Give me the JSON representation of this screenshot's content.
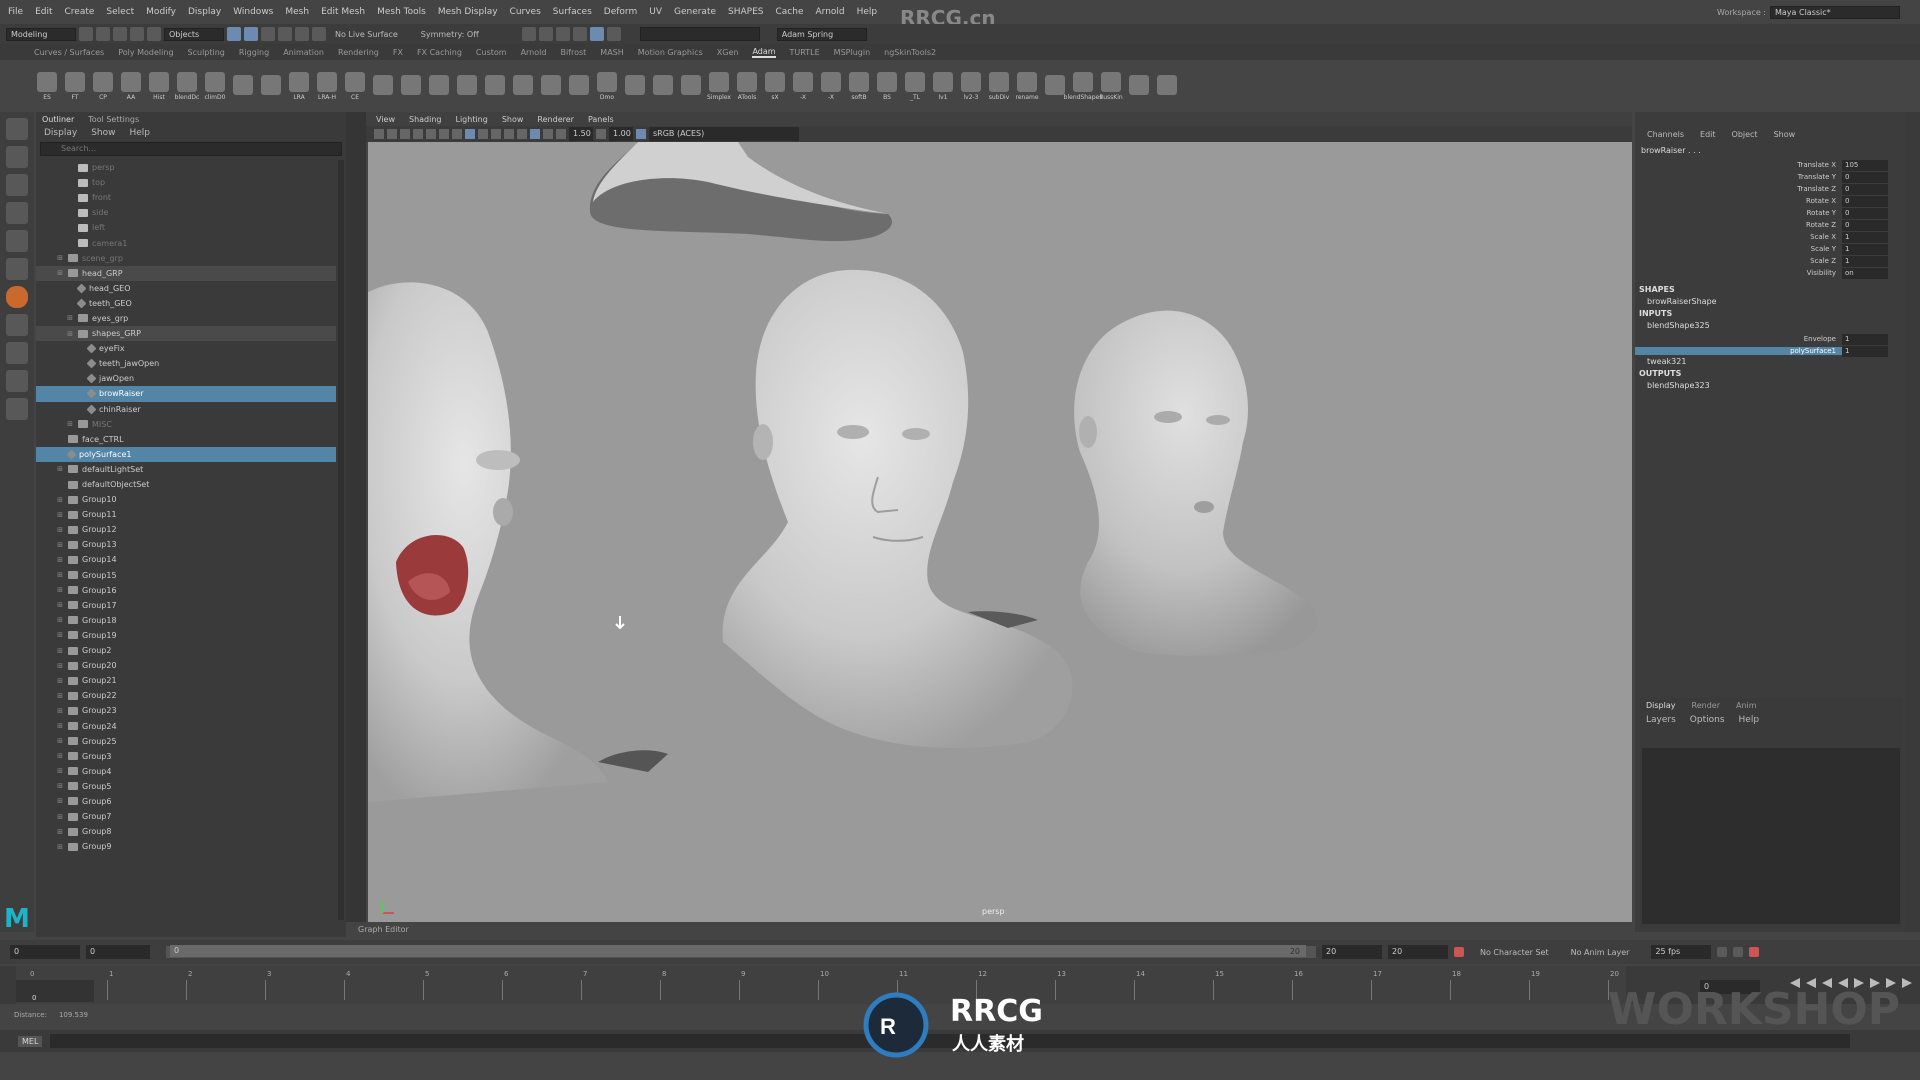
{
  "watermark": "RRCG.cn",
  "menubar": [
    "File",
    "Edit",
    "Create",
    "Select",
    "Modify",
    "Display",
    "Windows",
    "Mesh",
    "Edit Mesh",
    "Mesh Tools",
    "Mesh Display",
    "Curves",
    "Surfaces",
    "Deform",
    "UV",
    "Generate",
    "SHAPES",
    "Cache",
    "Arnold",
    "Help"
  ],
  "workspace": {
    "label": "Workspace :",
    "value": "Maya Classic*"
  },
  "statusline": {
    "mode": "Modeling",
    "objects": "Objects",
    "live": "No Live Surface",
    "symmetry": "Symmetry: Off",
    "user": "Adam Spring"
  },
  "shelf_tabs": [
    "Curves / Surfaces",
    "Poly Modeling",
    "Sculpting",
    "Rigging",
    "Animation",
    "Rendering",
    "FX",
    "FX Caching",
    "Custom",
    "Arnold",
    "Bifrost",
    "MASH",
    "Motion Graphics",
    "XGen",
    "Adam",
    "TURTLE",
    "MSPlugin",
    "ngSkinTools2"
  ],
  "shelf_active": "Adam",
  "shelf_icons": [
    "ES",
    "FT",
    "CP",
    "AA",
    "Hist",
    "blendDc",
    "climD0",
    "",
    "",
    "LRA",
    "LRA-H",
    "CE",
    "",
    "",
    "",
    "",
    "",
    "",
    "",
    "",
    "Dmo",
    "",
    "",
    "",
    "Simplex",
    "ATools",
    "sX",
    "-X",
    "-X",
    "softB",
    "BS",
    "_TL",
    "lv1",
    "lv2-3",
    "subDiv",
    "rename",
    "",
    "blendShapes",
    "RussKin",
    "",
    ""
  ],
  "outliner": {
    "tabs": [
      "Outliner",
      "Tool Settings"
    ],
    "menu": [
      "Display",
      "Show",
      "Help"
    ],
    "search": "Search..."
  },
  "tree": [
    {
      "label": "persp",
      "indent": 2,
      "icon": "cam",
      "dim": true
    },
    {
      "label": "top",
      "indent": 2,
      "icon": "cam",
      "dim": true
    },
    {
      "label": "front",
      "indent": 2,
      "icon": "cam",
      "dim": true
    },
    {
      "label": "side",
      "indent": 2,
      "icon": "cam",
      "dim": true
    },
    {
      "label": "left",
      "indent": 2,
      "icon": "cam",
      "dim": true
    },
    {
      "label": "camera1",
      "indent": 2,
      "icon": "cam",
      "dim": true
    },
    {
      "label": "scene_grp",
      "indent": 1,
      "icon": "grp",
      "exp": "+",
      "dim": true
    },
    {
      "label": "head_GRP",
      "indent": 1,
      "icon": "grp",
      "exp": "-",
      "grp": true
    },
    {
      "label": "head_GEO",
      "indent": 2,
      "icon": "geo"
    },
    {
      "label": "teeth_GEO",
      "indent": 2,
      "icon": "geo"
    },
    {
      "label": "eyes_grp",
      "indent": 2,
      "icon": "grp",
      "exp": "+"
    },
    {
      "label": "shapes_GRP",
      "indent": 2,
      "icon": "grp",
      "exp": "-",
      "grp": true
    },
    {
      "label": "eyeFix",
      "indent": 3,
      "icon": "geo"
    },
    {
      "label": "teeth_jawOpen",
      "indent": 3,
      "icon": "geo"
    },
    {
      "label": "jawOpen",
      "indent": 3,
      "icon": "geo"
    },
    {
      "label": "browRaiser",
      "indent": 3,
      "icon": "geo",
      "sel": true
    },
    {
      "label": "chinRaiser",
      "indent": 3,
      "icon": "geo"
    },
    {
      "label": "MISC",
      "indent": 2,
      "icon": "grp",
      "exp": "+",
      "dim": true
    },
    {
      "label": "face_CTRL",
      "indent": 1,
      "icon": "grp"
    },
    {
      "label": "polySurface1",
      "indent": 1,
      "icon": "geo",
      "sel": true
    },
    {
      "label": "defaultLightSet",
      "indent": 1,
      "icon": "set",
      "exp": "+"
    },
    {
      "label": "defaultObjectSet",
      "indent": 1,
      "icon": "set"
    },
    {
      "label": "Group10",
      "indent": 1,
      "icon": "set",
      "exp": "+"
    },
    {
      "label": "Group11",
      "indent": 1,
      "icon": "set",
      "exp": "+"
    },
    {
      "label": "Group12",
      "indent": 1,
      "icon": "set",
      "exp": "+"
    },
    {
      "label": "Group13",
      "indent": 1,
      "icon": "set",
      "exp": "+"
    },
    {
      "label": "Group14",
      "indent": 1,
      "icon": "set",
      "exp": "+"
    },
    {
      "label": "Group15",
      "indent": 1,
      "icon": "set",
      "exp": "+"
    },
    {
      "label": "Group16",
      "indent": 1,
      "icon": "set",
      "exp": "+"
    },
    {
      "label": "Group17",
      "indent": 1,
      "icon": "set",
      "exp": "+"
    },
    {
      "label": "Group18",
      "indent": 1,
      "icon": "set",
      "exp": "+"
    },
    {
      "label": "Group19",
      "indent": 1,
      "icon": "set",
      "exp": "+"
    },
    {
      "label": "Group2",
      "indent": 1,
      "icon": "set",
      "exp": "+"
    },
    {
      "label": "Group20",
      "indent": 1,
      "icon": "set",
      "exp": "+"
    },
    {
      "label": "Group21",
      "indent": 1,
      "icon": "set",
      "exp": "+"
    },
    {
      "label": "Group22",
      "indent": 1,
      "icon": "set",
      "exp": "+"
    },
    {
      "label": "Group23",
      "indent": 1,
      "icon": "set",
      "exp": "+"
    },
    {
      "label": "Group24",
      "indent": 1,
      "icon": "set",
      "exp": "+"
    },
    {
      "label": "Group25",
      "indent": 1,
      "icon": "set",
      "exp": "+"
    },
    {
      "label": "Group3",
      "indent": 1,
      "icon": "set",
      "exp": "+"
    },
    {
      "label": "Group4",
      "indent": 1,
      "icon": "set",
      "exp": "+"
    },
    {
      "label": "Group5",
      "indent": 1,
      "icon": "set",
      "exp": "+"
    },
    {
      "label": "Group6",
      "indent": 1,
      "icon": "set",
      "exp": "+"
    },
    {
      "label": "Group7",
      "indent": 1,
      "icon": "set",
      "exp": "+"
    },
    {
      "label": "Group8",
      "indent": 1,
      "icon": "set",
      "exp": "+"
    },
    {
      "label": "Group9",
      "indent": 1,
      "icon": "set",
      "exp": "+"
    }
  ],
  "panel_menu": [
    "View",
    "Shading",
    "Lighting",
    "Show",
    "Renderer",
    "Panels"
  ],
  "panel_toolbar": {
    "exposure": "1.50",
    "gamma": "1.00",
    "colorspace": "sRGB (ACES)"
  },
  "viewport": {
    "camera": "persp"
  },
  "channelbox": {
    "menu": [
      "Channels",
      "Edit",
      "Object",
      "Show"
    ],
    "object": "browRaiser . . .",
    "attrs": [
      {
        "n": "Translate X",
        "v": "105"
      },
      {
        "n": "Translate Y",
        "v": "0"
      },
      {
        "n": "Translate Z",
        "v": "0"
      },
      {
        "n": "Rotate X",
        "v": "0"
      },
      {
        "n": "Rotate Y",
        "v": "0"
      },
      {
        "n": "Rotate Z",
        "v": "0"
      },
      {
        "n": "Scale X",
        "v": "1"
      },
      {
        "n": "Scale Y",
        "v": "1"
      },
      {
        "n": "Scale Z",
        "v": "1"
      },
      {
        "n": "Visibility",
        "v": "on"
      }
    ],
    "shapes_label": "SHAPES",
    "shape": "browRaiserShape",
    "inputs_label": "INPUTS",
    "input1": "blendShape325",
    "input_attrs": [
      {
        "n": "Envelope",
        "v": "1"
      },
      {
        "n": "polySurface1",
        "v": "1"
      }
    ],
    "input2": "tweak321",
    "outputs_label": "OUTPUTS",
    "output1": "blendShape323"
  },
  "layers": {
    "tabs": [
      "Display",
      "Render",
      "Anim"
    ],
    "menu": [
      "Layers",
      "Options",
      "Help"
    ]
  },
  "graph_editor": "Graph Editor",
  "range": {
    "start": "0",
    "start2": "0",
    "current": "0",
    "end_in": "20",
    "end": "20",
    "end2": "20",
    "charset": "No Character Set",
    "animlayer": "No Anim Layer",
    "fps": "25 fps"
  },
  "timeline_nums": [
    "0",
    "1",
    "2",
    "3",
    "4",
    "5",
    "6",
    "7",
    "8",
    "9",
    "10",
    "11",
    "12",
    "13",
    "14",
    "15",
    "16",
    "17",
    "18",
    "19",
    "20"
  ],
  "current_frame": "0",
  "current_frame_field": "0",
  "distance": {
    "label": "Distance:",
    "value": "109.539"
  },
  "cmdline": "MEL",
  "bottom_watermark": {
    "brand": "RRCG",
    "sub": "人人素材"
  },
  "gnomon": "WORKSHOP"
}
